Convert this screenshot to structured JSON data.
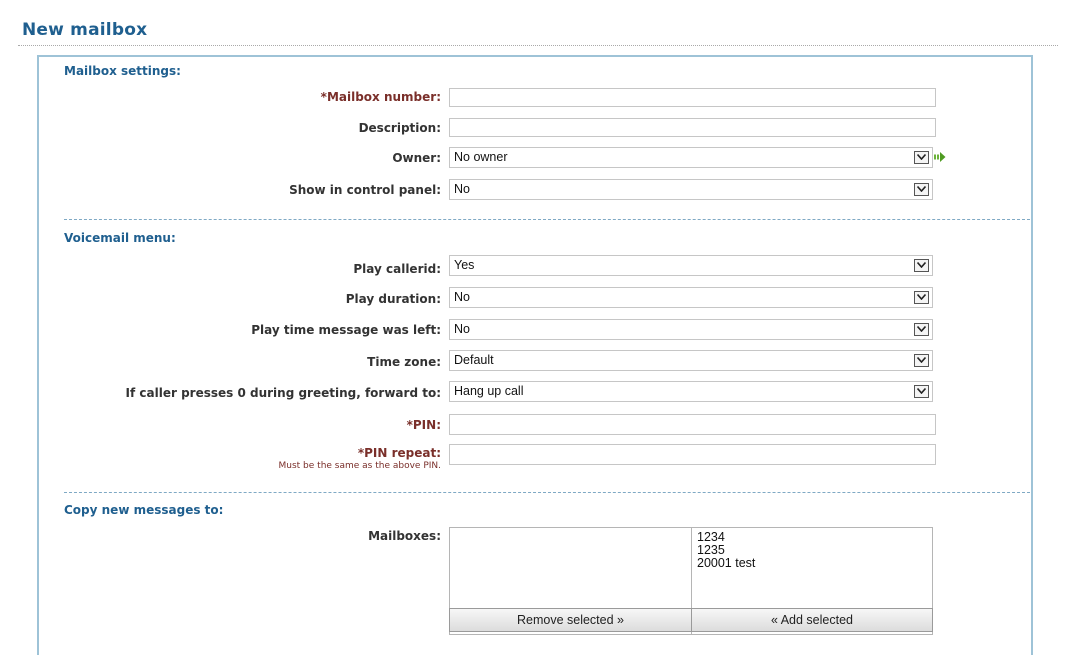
{
  "page": {
    "title": "New mailbox"
  },
  "mailbox_settings": {
    "title": "Mailbox settings:",
    "mailbox_number_label": "*Mailbox number:",
    "mailbox_number_value": "",
    "description_label": "Description:",
    "description_value": "",
    "owner_label": "Owner:",
    "owner_value": "No owner",
    "show_in_control_panel_label": "Show in control panel:",
    "show_in_control_panel_value": "No"
  },
  "voicemail_menu": {
    "title": "Voicemail menu:",
    "play_callerid_label": "Play callerid:",
    "play_callerid_value": "Yes",
    "play_duration_label": "Play duration:",
    "play_duration_value": "No",
    "play_time_label": "Play time message was left:",
    "play_time_value": "No",
    "time_zone_label": "Time zone:",
    "time_zone_value": "Default",
    "forward_label": "If caller presses 0 during greeting, forward to:",
    "forward_value": "Hang up call",
    "pin_label": "*PIN:",
    "pin_value": "",
    "pin_repeat_label": "*PIN repeat:",
    "pin_repeat_hint": "Must be the same as the above PIN.",
    "pin_repeat_value": ""
  },
  "copy_messages": {
    "title": "Copy new messages to:",
    "mailboxes_label": "Mailboxes:",
    "selected_items": [],
    "available_items": [
      "1234",
      "1235",
      "20001 test"
    ],
    "remove_button": "Remove selected »",
    "add_button": "« Add selected"
  },
  "icons": {
    "dropdown_arrow": "chevron-down-icon",
    "owner_go": "green-arrow-right-icon"
  },
  "colors": {
    "heading": "#1f5f8f",
    "required_label": "#7a2f2a",
    "panel_border": "#9ec3d7"
  }
}
